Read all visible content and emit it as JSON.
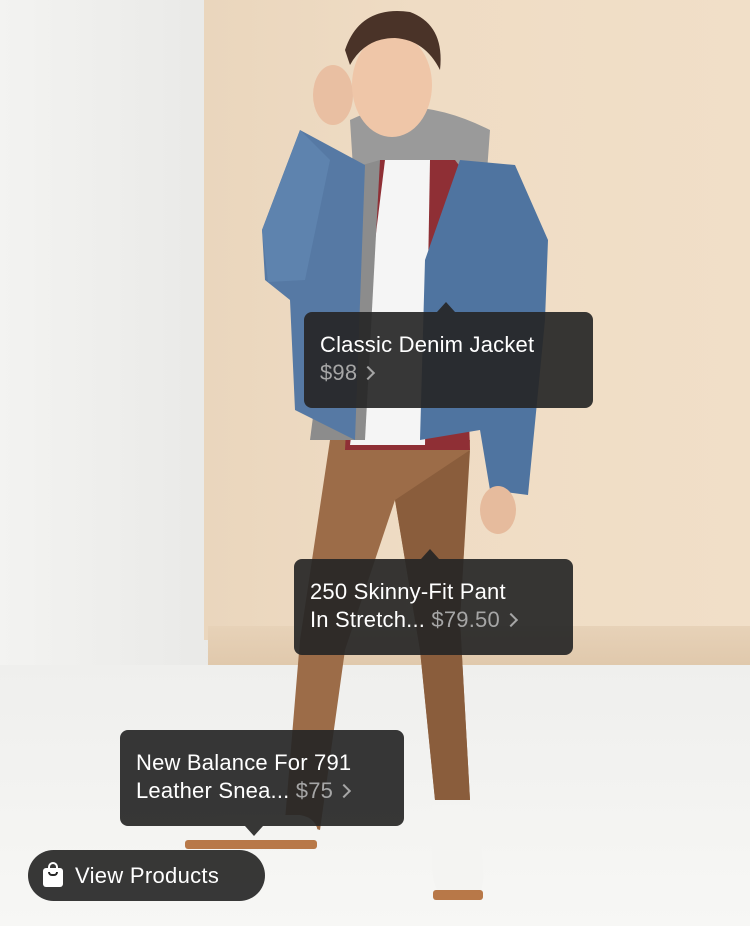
{
  "tags": [
    {
      "line1": "Classic Denim Jacket",
      "line2_name": "",
      "price": "$98"
    },
    {
      "line1": "250 Skinny-Fit Pant",
      "line2_name": "In Stretch...",
      "price": "$79.50"
    },
    {
      "line1": "New Balance For 791",
      "line2_name": "Leather Snea...",
      "price": "$75"
    }
  ],
  "view_products": {
    "label": "View Products",
    "icon": "shopping-bag-icon"
  },
  "colors": {
    "tag_bg": "#262626",
    "price_gray": "#a6a6a6",
    "paper": "#efdcc4"
  }
}
